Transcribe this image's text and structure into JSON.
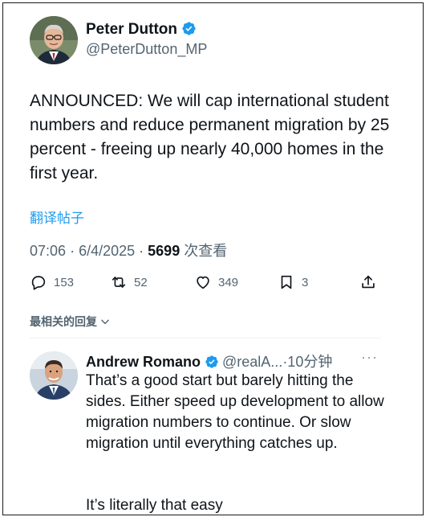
{
  "post": {
    "author_name": "Peter Dutton",
    "author_handle": "@PeterDutton_MP",
    "text": "ANNOUNCED: We will cap international student numbers and reduce permanent migration by 25 percent - freeing up nearly 40,000 homes in the first year.",
    "translate_label": "翻译帖子",
    "time": "07:06",
    "date": "6/4/2025",
    "views_count": "5699",
    "views_label": "次查看",
    "replies": "153",
    "reposts": "52",
    "likes": "349",
    "bookmarks": "3"
  },
  "replies_section": {
    "sort_label": "最相关的回复"
  },
  "reply": {
    "author_name": "Andrew Romano",
    "author_handle": "@realA...",
    "time_ago": "·10分钟",
    "more": "···",
    "text": "That’s a good start but barely hitting the sides. Either speed up development to allow migration numbers to continue. Or slow migration until everything catches up.",
    "text2": "It’s literally that easy"
  },
  "colors": {
    "link_blue": "#1d9bf0",
    "verified_blue": "#1d9bf0",
    "secondary_text": "#536471",
    "primary_text": "#0f1419"
  },
  "icons": [
    "verified-badge-icon",
    "reply-icon",
    "repost-icon",
    "like-icon",
    "bookmark-icon",
    "share-icon",
    "chevron-down-icon",
    "more-icon"
  ]
}
